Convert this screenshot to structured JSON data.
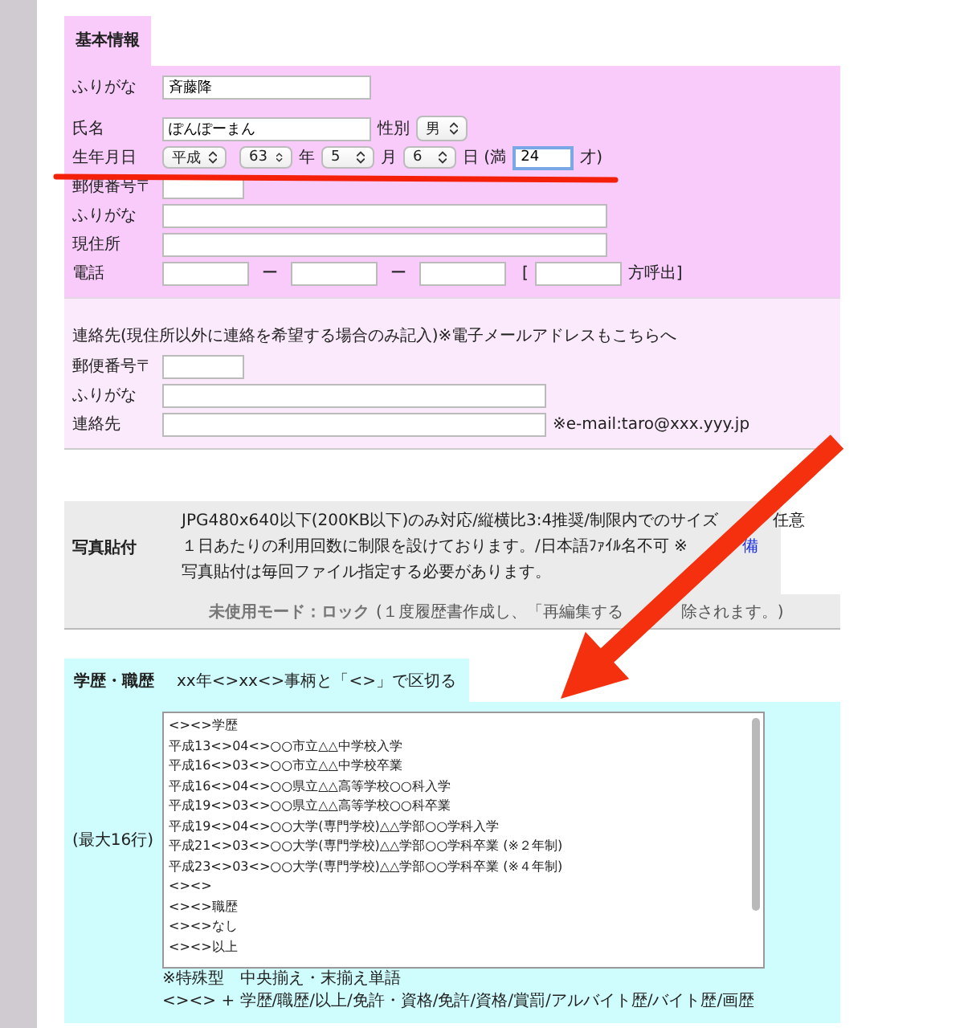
{
  "basic": {
    "tab": "基本情報",
    "furigana": {
      "label": "ふりがな",
      "value": "斉藤降"
    },
    "name": {
      "label": "氏名",
      "value": "ぽんぽーまん",
      "gender_label": "性別",
      "gender": "男"
    },
    "birth": {
      "label": "生年月日",
      "era": "平成",
      "year": "63",
      "year_unit": "年",
      "month": "5",
      "month_unit": "月",
      "day": "6",
      "day_unit": "日",
      "age_prefix": "(満",
      "age": "24",
      "age_suffix": "才)"
    },
    "postal": {
      "label": "郵便番号〒"
    },
    "kana": {
      "label": "ふりがな"
    },
    "address": {
      "label": "現住所"
    },
    "phone": {
      "label": "電話",
      "dash1": "ー",
      "dash2": "ー",
      "open": "[",
      "suffix": "方呼出]"
    }
  },
  "contact": {
    "note": "連絡先(現住所以外に連絡を希望する場合のみ記入)※電子メールアドレスもこちらへ",
    "postal": {
      "label": "郵便番号〒"
    },
    "kana": {
      "label": "ふりがな"
    },
    "contact": {
      "label": "連絡先",
      "hint": "※e-mail:taro@xxx.yyy.jp"
    }
  },
  "photo": {
    "label": "写真貼付",
    "lines": [
      {
        "before": "JPG480x640以下(200KB以下)のみ対応/縦横比3:4推奨/制限内でのサイズ",
        "after": "任意"
      },
      {
        "before": "１日あたりの利用回数に制限を設けております。/日本語ﾌｧｲﾙ名不可 ※",
        "link": "備"
      },
      {
        "before": "写真貼付は毎回ファイル指定する必要があります。"
      }
    ],
    "mode": "未使用モード：ロック",
    "mode_note": "(１度履歴書作成し、「再編集する",
    "mode_note_after": "除されます。)"
  },
  "history": {
    "tab": "学歴・職歴",
    "hint": "xx年<>xx<>事柄と「<>」で区切る",
    "max": "(最大16行)",
    "lines": [
      "<><>学歴",
      "平成13<>04<>○○市立△△中学校入学",
      "平成16<>03<>○○市立△△中学校卒業",
      "平成16<>04<>○○県立△△高等学校○○科入学",
      "平成19<>03<>○○県立△△高等学校○○科卒業",
      "平成19<>04<>○○大学(専門学校)△△学部○○学科入学",
      "平成21<>03<>○○大学(専門学校)△△学部○○学科卒業 (※２年制)",
      "平成23<>03<>○○大学(専門学校)△△学部○○学科卒業 (※４年制)",
      "<><>",
      "<><>職歴",
      "<><>なし",
      "<><>以上"
    ],
    "notes": [
      "※特殊型　中央揃え・末揃え単語",
      "<><> + 学歴/職歴/以上/免許・資格/免許/資格/賞罰/アルバイト歴/バイト歴/画歴"
    ]
  }
}
